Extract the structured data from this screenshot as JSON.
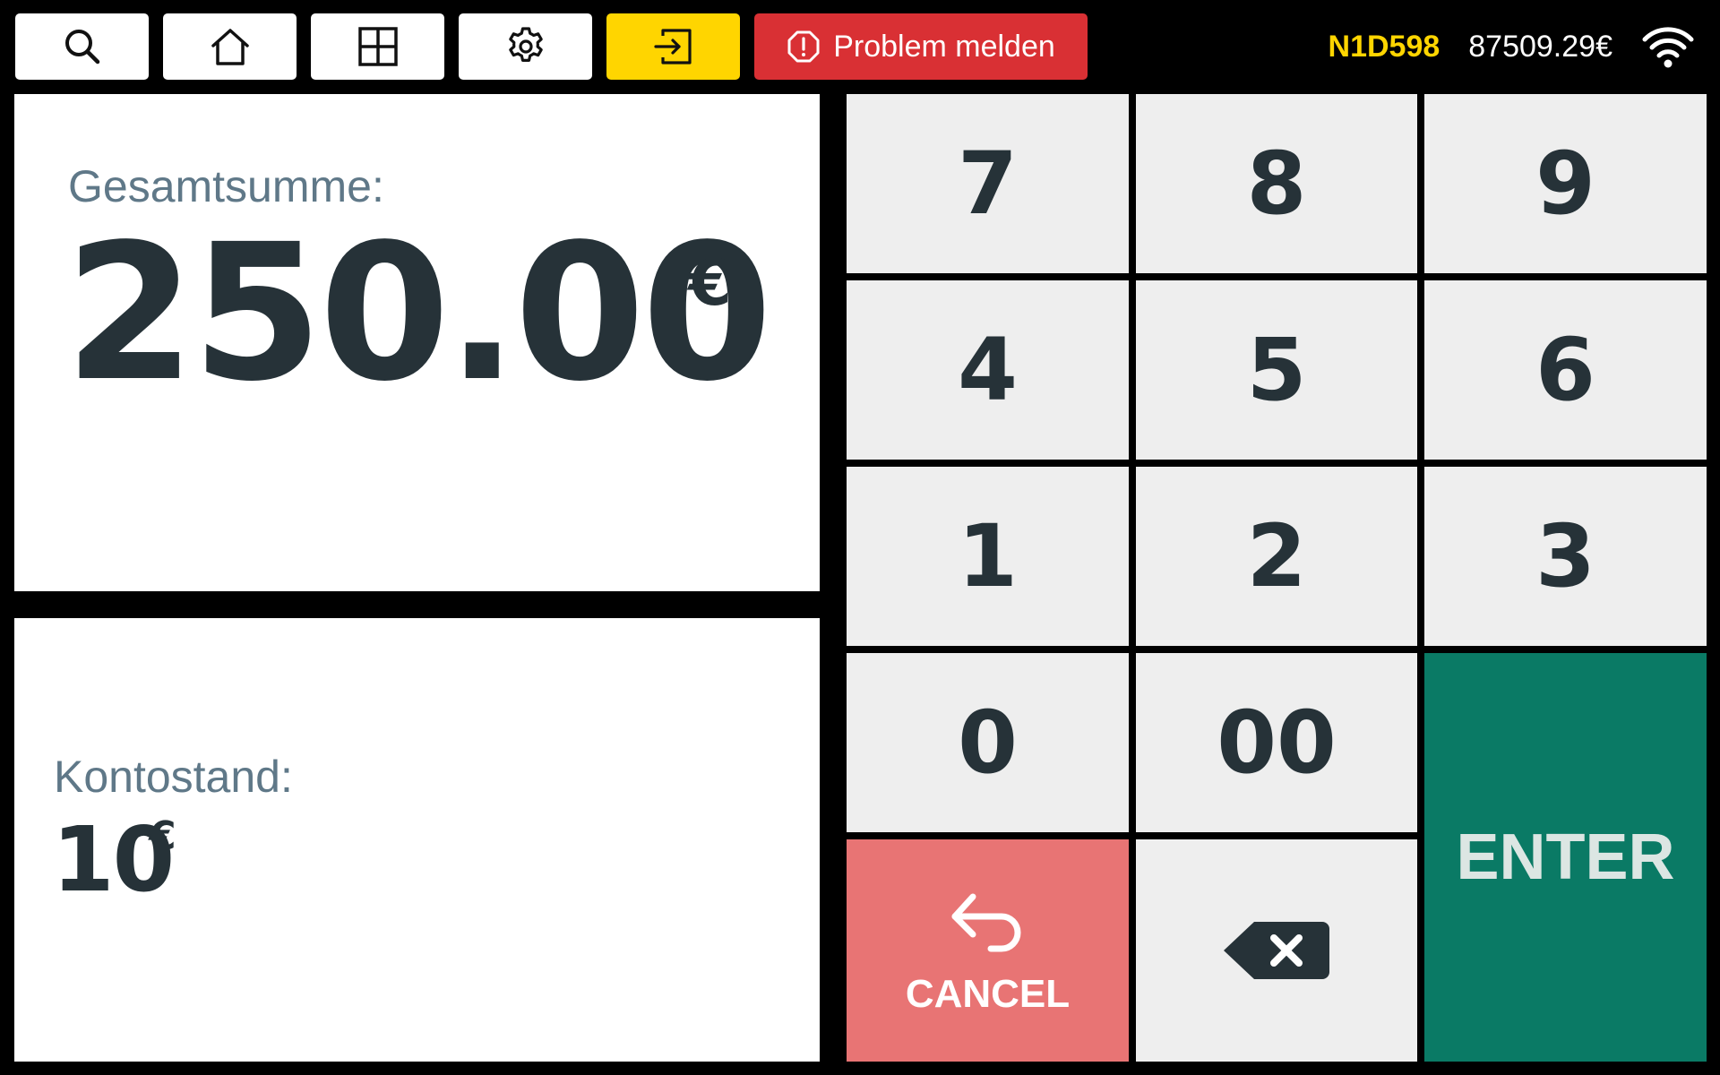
{
  "toolbar": {
    "search_icon": "search-icon",
    "home_icon": "home-icon",
    "grid_icon": "grid-icon",
    "settings_icon": "gear-icon",
    "logout_icon": "logout-icon",
    "problem_label": "Problem melden",
    "problem_icon": "alert-icon"
  },
  "status": {
    "device_id": "N1D598",
    "balance": "87509.29€",
    "wifi_icon": "wifi-icon"
  },
  "total": {
    "label": "Gesamtsumme:",
    "amount": "250.00",
    "currency": "€"
  },
  "account": {
    "label": "Kontostand:",
    "amount": "10",
    "currency": "€"
  },
  "keypad": {
    "keys": [
      "7",
      "8",
      "9",
      "4",
      "5",
      "6",
      "1",
      "2",
      "3",
      "0",
      "00"
    ],
    "enter_label": "ENTER",
    "cancel_label": "CANCEL",
    "cancel_icon": "undo-arrow-icon",
    "backspace_icon": "backspace-icon"
  },
  "colors": {
    "yellow_accent": "#FFD500",
    "problem_red": "#D93034",
    "enter_green": "#0A7A65",
    "cancel_red": "#E87474",
    "key_gray": "#EEEEEE",
    "text_dark": "#263238",
    "label_gray": "#5F7888"
  }
}
